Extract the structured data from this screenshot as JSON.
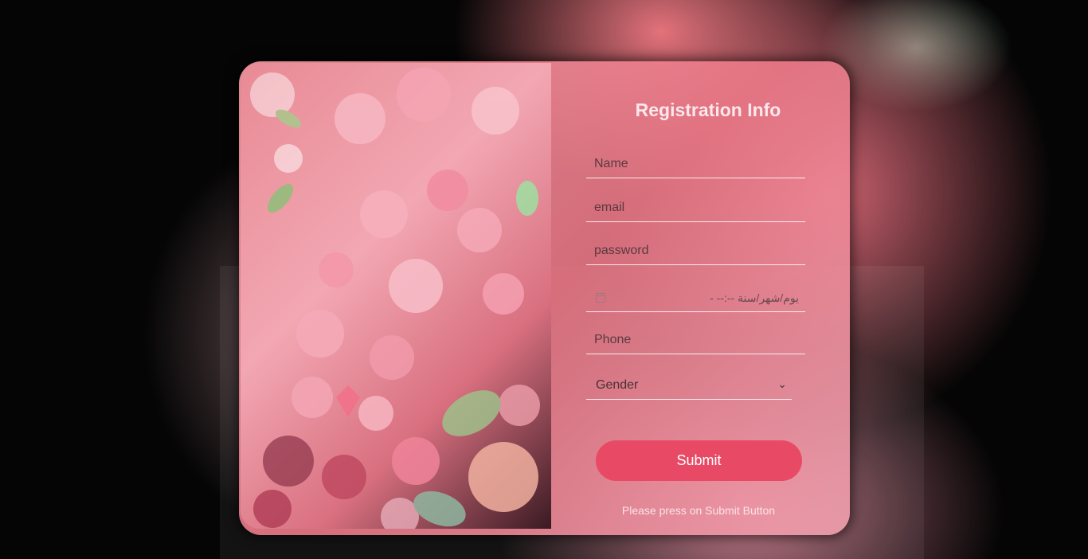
{
  "form": {
    "title": "Registration Info",
    "name_placeholder": "Name",
    "email_placeholder": "email",
    "password_placeholder": "password",
    "date_placeholder": "يوم/شهر/سنة  --:-- -",
    "phone_placeholder": "Phone",
    "gender_selected": "Gender",
    "submit_label": "Submit",
    "hint": "Please press on Submit Button"
  },
  "icons": {
    "calendar": "calendar-icon",
    "chevron": "chevron-down-icon"
  },
  "colors": {
    "accent": "#e84a66",
    "card": "#ec8f9c",
    "background": "#050505"
  }
}
